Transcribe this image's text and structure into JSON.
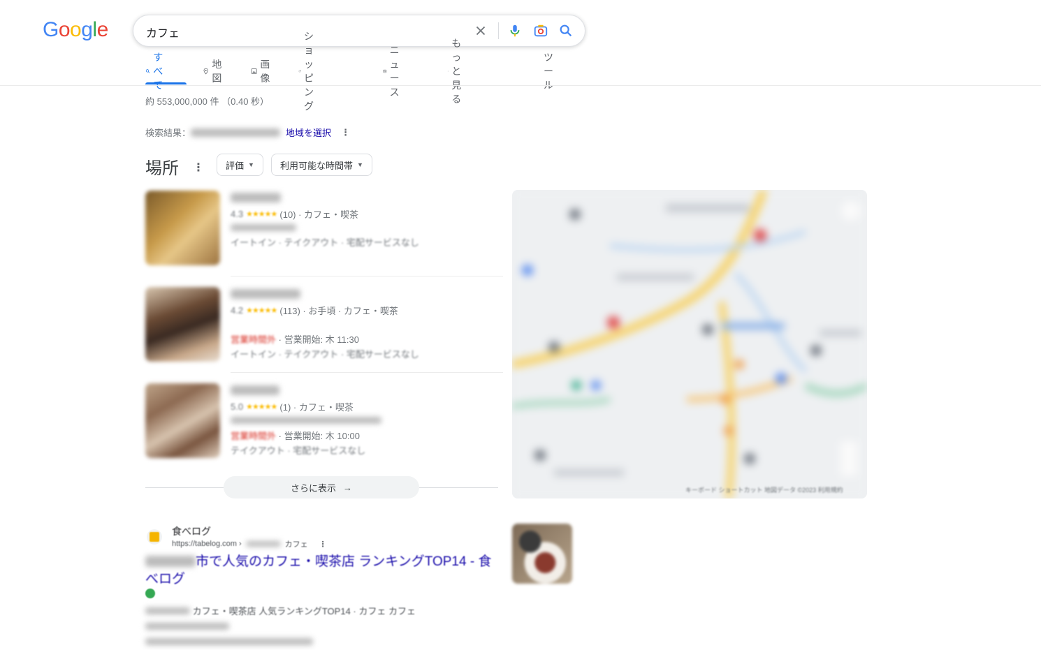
{
  "header": {
    "logo": "Google",
    "logo_colors": [
      "#4285F4",
      "#EA4335",
      "#FBBC05",
      "#4285F4",
      "#34A853",
      "#EA4335"
    ],
    "query": "カフェ"
  },
  "tabs": [
    {
      "label": "すべて",
      "icon": "search-icon",
      "active": true
    },
    {
      "label": "地図",
      "icon": "map-pin-icon",
      "active": false
    },
    {
      "label": "画像",
      "icon": "image-icon",
      "active": false
    },
    {
      "label": "ショッピング",
      "icon": "tag-icon",
      "active": false
    },
    {
      "label": "ニュース",
      "icon": "news-icon",
      "active": false
    },
    {
      "label": "もっと見る",
      "icon": "more-vert-icon",
      "active": false
    }
  ],
  "tools_label": "ツール",
  "result_stats": "約 553,000,000 件 （0.40 秒）",
  "location": {
    "prefix": "検索結果：",
    "link": "地域を選択"
  },
  "places": {
    "title": "場所",
    "chips": [
      {
        "label": "評価"
      },
      {
        "label": "利用可能な時間帯"
      }
    ],
    "items": [
      {
        "rating": "4.3",
        "stars": "★★★★★",
        "reviews": "(10) · カフェ・喫茶",
        "status": "",
        "hours": "",
        "services": "イートイン · テイクアウト · 宅配サービスなし"
      },
      {
        "rating": "4.2",
        "stars": "★★★★★",
        "reviews": "(113) · お手頃 · カフェ・喫茶",
        "status": "営業時間外",
        "hours": " · 営業開始: 木 11:30",
        "services": "イートイン · テイクアウト · 宅配サービスなし"
      },
      {
        "rating": "5.0",
        "stars": "★★★★★",
        "reviews": "(1) · カフェ・喫茶",
        "status": "営業時間外",
        "hours": " · 営業開始: 木 10:00",
        "services": "テイクアウト · 宅配サービスなし"
      }
    ],
    "more_label": "さらに表示"
  },
  "map": {
    "attribution": "キーボード ショートカット 地図データ ©2023 利用規約"
  },
  "web_result": {
    "site_name": "食べログ",
    "url": "https://tabelog.com ›",
    "url_tail": "カフェ",
    "title": "市で人気のカフェ・喫茶店 ランキングTOP14 - 食べログ",
    "snippet": "カフェ・喫茶店 人気ランキングTOP14 · カフェ カフェ"
  }
}
